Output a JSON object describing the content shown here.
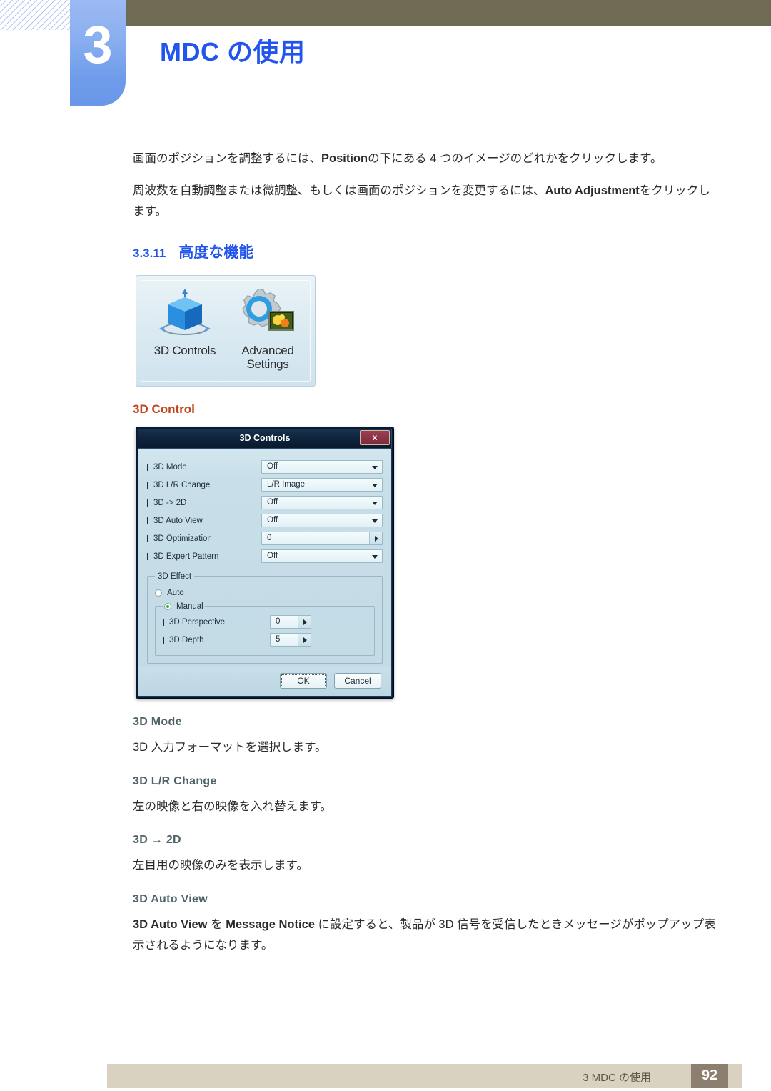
{
  "header": {
    "chapter_number": "3",
    "chapter_title": "MDC の使用",
    "band_color": "#6e6a53",
    "tab_color": "#8bb0f0",
    "title_color": "#2255ee"
  },
  "intro": {
    "para1_prefix": "画面のポジションを調整するには、",
    "para1_bold": "Position",
    "para1_suffix": "の下にある 4 つのイメージのどれかをクリックします。",
    "para2_prefix": "周波数を自動調整または微調整、もしくは画面のポジションを変更するには、",
    "para2_bold": "Auto Adjustment",
    "para2_suffix": "をクリックします。"
  },
  "section": {
    "number": "3.3.11",
    "title": "高度な機能"
  },
  "toolbar_figure": {
    "items": [
      {
        "label_line1": "3D Controls",
        "label_line2": "",
        "icon": "blue-cube-icon"
      },
      {
        "label_line1": "Advanced",
        "label_line2": "Settings",
        "icon": "gear-picture-icon"
      }
    ]
  },
  "subheading_3d_control": {
    "text": "3D Control",
    "color": "#c1441a"
  },
  "dialog": {
    "title": "3D Controls",
    "close_label": "x",
    "fields": [
      {
        "label": "3D Mode",
        "value": "Off",
        "control": "dropdown"
      },
      {
        "label": "3D L/R Change",
        "value": "L/R Image",
        "control": "dropdown"
      },
      {
        "label": "3D -> 2D",
        "value": "Off",
        "control": "dropdown"
      },
      {
        "label": "3D Auto View",
        "value": "Off",
        "control": "dropdown"
      },
      {
        "label": "3D Optimization",
        "value": "0",
        "control": "spinner"
      },
      {
        "label": "3D Expert Pattern",
        "value": "Off",
        "control": "dropdown"
      }
    ],
    "effect_group": {
      "legend": "3D Effect",
      "auto_label": "Auto",
      "auto_selected": false,
      "manual_label": "Manual",
      "manual_selected": true,
      "manual_fields": [
        {
          "label": "3D Perspective",
          "value": "0"
        },
        {
          "label": "3D Depth",
          "value": "5"
        }
      ]
    },
    "buttons": {
      "ok": "OK",
      "cancel": "Cancel"
    }
  },
  "descriptions": [
    {
      "term": "3D Mode",
      "text": "3D 入力フォーマットを選択します。"
    },
    {
      "term": "3D L/R Change",
      "text": "左の映像と右の映像を入れ替えます。"
    },
    {
      "term": "3D → 2D",
      "text": "左目用の映像のみを表示します。"
    },
    {
      "term": "3D Auto View",
      "text": ""
    }
  ],
  "final_para": {
    "bold1": "3D Auto View",
    "mid1": " を ",
    "bold2": "Message Notice",
    "suffix": " に設定すると、製品が 3D 信号を受信したときメッセージがポップアップ表示されるようになります。"
  },
  "footer": {
    "text": "3 MDC の使用",
    "page_number": "92",
    "band_color": "#d9d2c0",
    "page_box_color": "#8d7f6f"
  }
}
